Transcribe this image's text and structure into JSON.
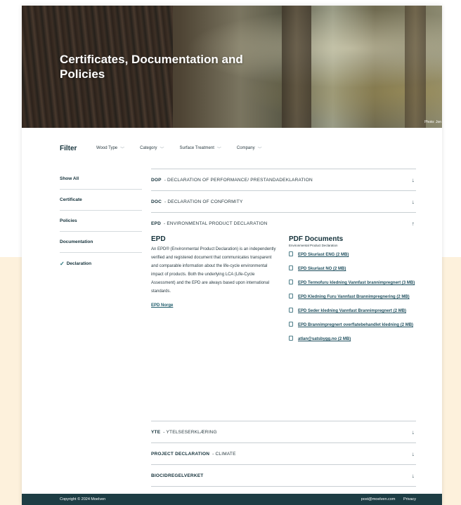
{
  "hero": {
    "title": "Certificates, Documentation and Policies",
    "photo_credit": "Photo: Jon"
  },
  "filter": {
    "title": "Filter",
    "dropdowns": [
      "Wood Type",
      "Category",
      "Surface Treatment",
      "Company"
    ]
  },
  "sidebar": {
    "items": [
      {
        "label": "Show All",
        "checked": false
      },
      {
        "label": "Certificate",
        "checked": false
      },
      {
        "label": "Policies",
        "checked": false
      },
      {
        "label": "Documentation",
        "checked": false
      },
      {
        "label": "Declaration",
        "checked": true
      }
    ]
  },
  "accordion": {
    "items": [
      {
        "code": "DOP",
        "label": "- DECLARATION OF PERFORMANCE/ PRESTANDADEKLARATION",
        "expanded": false
      },
      {
        "code": "DOC",
        "label": "- DECLARATION OF CONFORMITY",
        "expanded": false
      },
      {
        "code": "EPD",
        "label": "- ENVIRONMENTAL PRODUCT DECLARATION",
        "expanded": true
      },
      {
        "code": "YTE",
        "label": "- YTELSESERKLÆRING",
        "expanded": false
      },
      {
        "code": "PROJECT DECLARATION",
        "label": "- CLIMATE",
        "expanded": false
      },
      {
        "code": "BIOCIDREGELVERKET",
        "label": "",
        "expanded": false
      }
    ],
    "epd": {
      "title": "EPD",
      "description": "An EPD® (Environmental Product Declaration) is an independently verified and registered document that communicates transparent and comparable information about the life-cycle environmental impact of products. Both the underlying LCA (Life-Cycle Assessment) and the EPD are always based upon international standards.",
      "link": "EPD Norge"
    },
    "pdf": {
      "title": "PDF Documents",
      "subtitle": "Environmental Product Declaration",
      "documents": [
        "EPD Skurlast ENG (2 MB)",
        "EPD Skurlast NO (2 MB)",
        "EPD Termofuru kledning Vannfast brannimpregnert (3 MB)",
        "EPD Kledning Furu Vannfast Brannimpregnering (2 MB)",
        "EPD Seder kledning Vannfast Brannimpregnert (2 MB)",
        "EPD Brannimpregnert overflatebehandlet kledning (2 MB)",
        "atlan@satsbygg.no (2 MB)"
      ]
    }
  },
  "footer": {
    "copyright": "Copyright © 2024 Moelven",
    "email": "post@moelven.com",
    "privacy": "Privacy"
  },
  "icons": {
    "dropdown": "chevron-down-icon",
    "collapsed": "arrow-down-icon",
    "expanded": "arrow-up-icon",
    "checked": "check-icon",
    "document": "document-icon"
  },
  "colors": {
    "footer_bg": "#1d3d44",
    "cream_bg": "#fdf1dc",
    "link": "#1f4f5e"
  }
}
